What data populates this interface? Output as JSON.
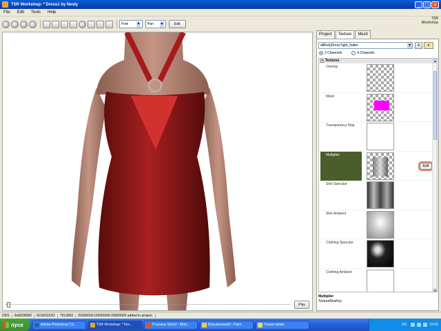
{
  "window": {
    "title": "TSR Workshop: * Dress1 by Nesty"
  },
  "menu": [
    "File",
    "Edit",
    "Tools",
    "Help"
  ],
  "logo": "TSR Workshop",
  "toolbar": {
    "camera_mode": "Free",
    "pan_mode": "Pan",
    "edit_label": "Edit"
  },
  "viewport": {
    "play_label": "Play"
  },
  "panel": {
    "tabs": [
      "Project",
      "Texture",
      "Mesh"
    ],
    "texture_name": "afBodyDressTight_halter",
    "add_button": "A",
    "channels": [
      {
        "label": "3 Channels",
        "selected": true
      },
      {
        "label": "4 Channels",
        "selected": false
      }
    ],
    "textures_header": "Textures",
    "rows": [
      {
        "label": "Overlay",
        "thumb": "checker"
      },
      {
        "label": "Mask",
        "thumb": "mask"
      },
      {
        "label": "Transparency Map",
        "thumb": "white"
      },
      {
        "label": "Multiplier",
        "thumb": "multiplier",
        "selected": true
      },
      {
        "label": "Skin Specular",
        "thumb": "specular"
      },
      {
        "label": "Skin Ambient",
        "thumb": "ambient"
      },
      {
        "label": "Clothing Specular",
        "thumb": "cloth-spec"
      },
      {
        "label": "Clothing Ambient",
        "thumb": "white"
      }
    ],
    "edit_label": "Edit",
    "description_title": "Multiplier",
    "description_text": "TextureResKey"
  },
  "status": [
    "DDS",
    "0x82D8082",
    "6C669152D",
    "7913802",
    "00000000-00000000-00000000 added to project."
  ],
  "taskbar": {
    "start": "пуск",
    "tasks": [
      {
        "label": "Adobe Photoshop CS...",
        "color": "#2f5fb5",
        "active": false
      },
      {
        "label": "TSR Workshop: * Dre...",
        "color": "#e9a02a",
        "active": true
      },
      {
        "label": "Плагины Sims3 - Mod...",
        "color": "#d4542b",
        "active": false
      },
      {
        "label": "Безымянный3 - Paint",
        "color": "#f3c84a",
        "active": false
      },
      {
        "label": "Новая папка",
        "color": "#f3d36b",
        "active": false
      }
    ],
    "lang": "RU",
    "clock": "22:05"
  },
  "colors": {
    "dress": "#8e1a1a",
    "dress_insert": "#d2322e",
    "skin": "#b08070",
    "selection": "#4b5d2b",
    "mask_pink": "#ff00ff"
  }
}
